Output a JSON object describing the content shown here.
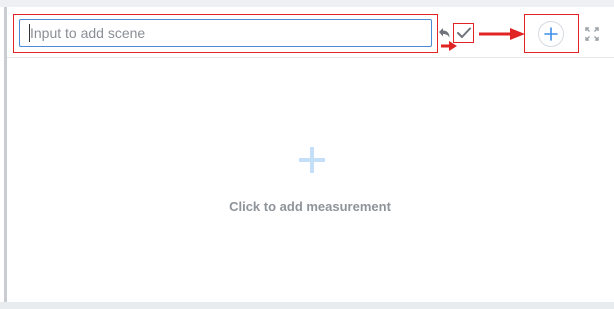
{
  "toolbar": {
    "scene_input": {
      "value": "",
      "placeholder": "Input to add scene"
    },
    "icons": {
      "undo": "undo-icon",
      "confirm": "check-icon",
      "add": "plus-icon",
      "fullscreen": "fullscreen-icon"
    }
  },
  "main": {
    "empty_state": {
      "icon": "plus-icon",
      "label": "Click to add measurement"
    }
  },
  "colors": {
    "accent": "#3d8ee8",
    "annotation": "#e02424",
    "input_border": "#4a8ad6",
    "muted_text": "#8f949a",
    "light_plus": "#c5dff8"
  }
}
